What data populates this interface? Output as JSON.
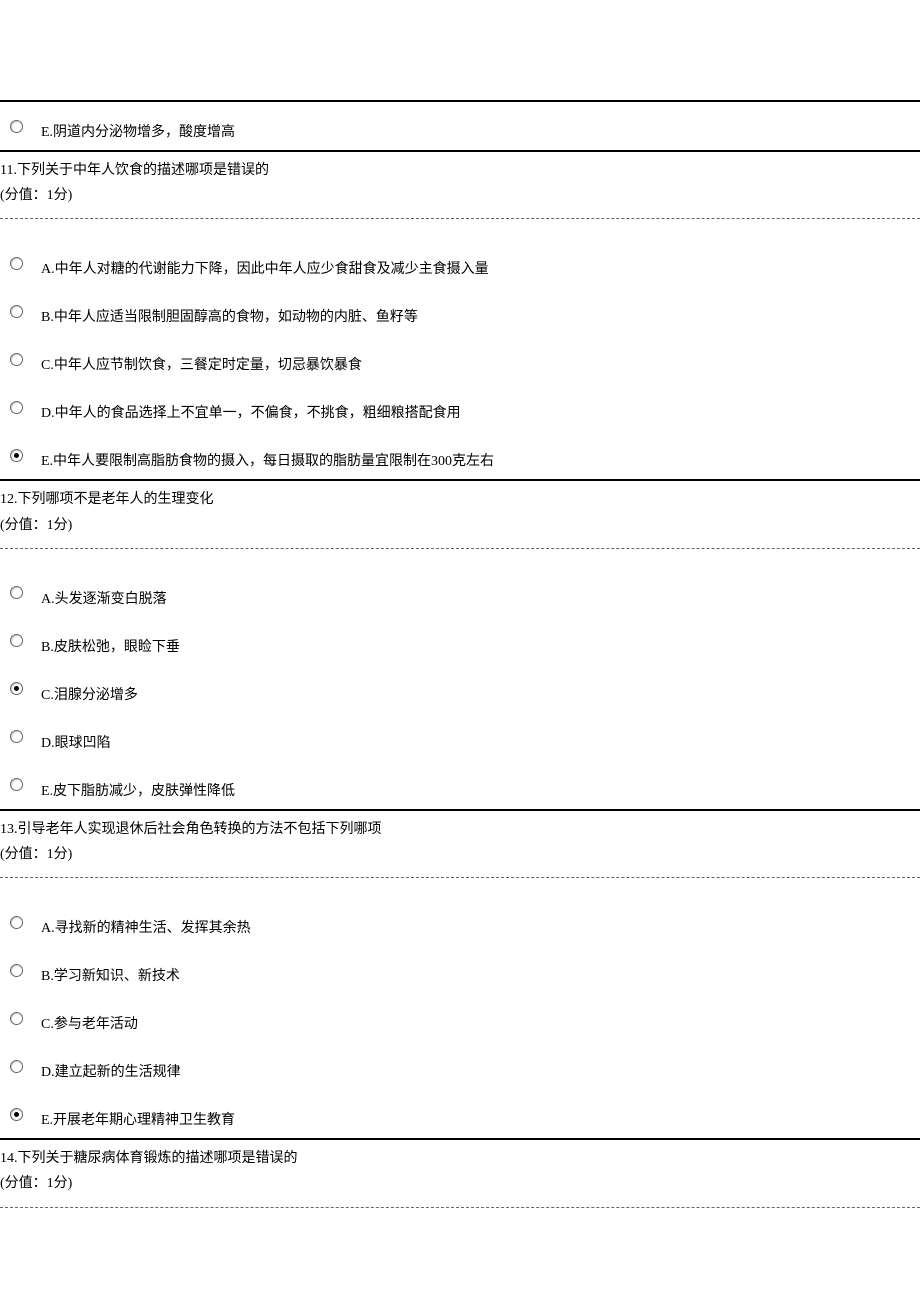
{
  "orphan_option": {
    "letter": "E",
    "text": "E.阴道内分泌物增多，酸度增高",
    "selected": false
  },
  "questions": [
    {
      "number": "11",
      "title": "11.下列关于中年人饮食的描述哪项是错误的",
      "score": "(分值：1分)",
      "options": [
        {
          "text": "A.中年人对糖的代谢能力下降，因此中年人应少食甜食及减少主食摄入量",
          "selected": false
        },
        {
          "text": "B.中年人应适当限制胆固醇高的食物，如动物的内脏、鱼籽等",
          "selected": false
        },
        {
          "text": "C.中年人应节制饮食，三餐定时定量，切忌暴饮暴食",
          "selected": false
        },
        {
          "text": "D.中年人的食品选择上不宜单一，不偏食，不挑食，粗细粮搭配食用",
          "selected": false
        },
        {
          "text": "E.中年人要限制高脂肪食物的摄入，每日摄取的脂肪量宜限制在300克左右",
          "selected": true
        }
      ]
    },
    {
      "number": "12",
      "title": "12.下列哪项不是老年人的生理变化",
      "score": "(分值：1分)",
      "options": [
        {
          "text": "A.头发逐渐变白脱落",
          "selected": false
        },
        {
          "text": "B.皮肤松弛，眼睑下垂",
          "selected": false
        },
        {
          "text": "C.泪腺分泌增多",
          "selected": true
        },
        {
          "text": "D.眼球凹陷",
          "selected": false
        },
        {
          "text": "E.皮下脂肪减少，皮肤弹性降低",
          "selected": false
        }
      ]
    },
    {
      "number": "13",
      "title": "13.引导老年人实现退休后社会角色转换的方法不包括下列哪项",
      "score": "(分值：1分)",
      "options": [
        {
          "text": "A.寻找新的精神生活、发挥其余热",
          "selected": false
        },
        {
          "text": "B.学习新知识、新技术",
          "selected": false
        },
        {
          "text": "C.参与老年活动",
          "selected": false
        },
        {
          "text": "D.建立起新的生活规律",
          "selected": false
        },
        {
          "text": "E.开展老年期心理精神卫生教育",
          "selected": true
        }
      ]
    },
    {
      "number": "14",
      "title": "14.下列关于糖尿病体育锻炼的描述哪项是错误的",
      "score": "(分值：1分)",
      "options": []
    }
  ]
}
